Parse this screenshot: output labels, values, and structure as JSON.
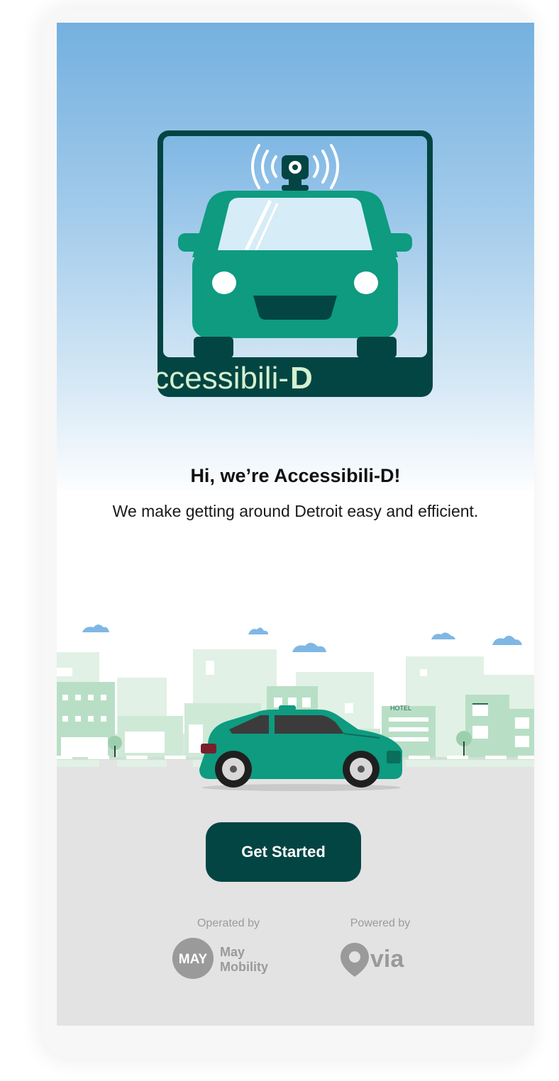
{
  "logo": {
    "text_main": "accessibili-",
    "text_bold": "D"
  },
  "welcome": {
    "title": "Hi, we’re Accessibili-D!",
    "subtitle": "We make getting around Detroit easy and efficient."
  },
  "scene": {
    "hotel_sign": "HOTEL"
  },
  "cta": {
    "label": "Get Started"
  },
  "footer": {
    "operated_label": "Operated by",
    "operator_badge": "MAY",
    "operator_line1": "May",
    "operator_line2": "Mobility",
    "powered_label": "Powered by",
    "partner_name": "via"
  },
  "colors": {
    "brand_dark": "#034543",
    "vehicle_green": "#0e9b80",
    "sky_top": "#74b0df",
    "road_gray": "#e3e3e3"
  }
}
